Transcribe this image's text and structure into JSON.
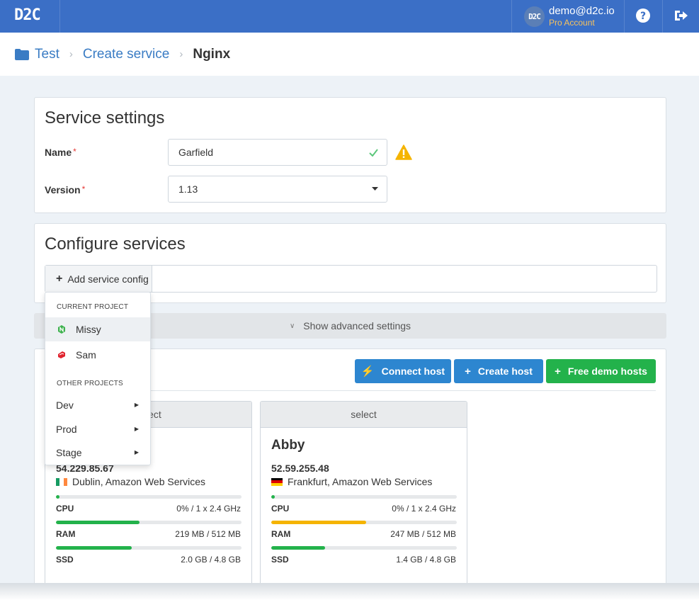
{
  "app": {
    "logo": "D2C"
  },
  "account": {
    "avatar_text": "D2C",
    "email": "demo@d2c.io",
    "plan": "Pro Account"
  },
  "breadcrumb": {
    "project": "Test",
    "step": "Create service",
    "current": "Nginx"
  },
  "service_settings": {
    "title": "Service settings",
    "name_label": "Name",
    "name_value": "Garfield",
    "version_label": "Version",
    "version_value": "1.13",
    "required_mark": "*"
  },
  "configure_services": {
    "title": "Configure services",
    "add_button_label": "Add service config"
  },
  "advanced": {
    "label": "Show advanced settings"
  },
  "hosts": {
    "buttons": {
      "connect": "Connect host",
      "create": "Create host",
      "demo": "Free demo hosts"
    },
    "cards": [
      {
        "select_label": "select",
        "name": "",
        "ip": "54.229.85.67",
        "location": "Dublin, Amazon Web Services",
        "flag_colors": [
          "#169b62",
          "#ffffff",
          "#ff883e"
        ],
        "cpu_label": "CPU",
        "cpu_value": "0% / 1 x 2.4 GHz",
        "cpu_fraction": 0.02,
        "cpu_color": "#23b24b",
        "ram_label": "RAM",
        "ram_value": "219 MB / 512 MB",
        "ram_fraction": 0.45,
        "ram_color": "#23b24b",
        "ssd_label": "SSD",
        "ssd_value": "2.0 GB / 4.8 GB",
        "ssd_fraction": 0.41,
        "ssd_color": "#23b24b"
      },
      {
        "select_label": "select",
        "name": "Abby",
        "ip": "52.59.255.48",
        "location": "Frankfurt, Amazon Web Services",
        "flag_colors": [
          "#000000",
          "#dd0000",
          "#ffce00"
        ],
        "cpu_label": "CPU",
        "cpu_value": "0% / 1 x 2.4 GHz",
        "cpu_fraction": 0.02,
        "cpu_color": "#23b24b",
        "ram_label": "RAM",
        "ram_value": "247 MB / 512 MB",
        "ram_fraction": 0.51,
        "ram_color": "#f5b400",
        "ssd_label": "SSD",
        "ssd_value": "1.4 GB / 4.8 GB",
        "ssd_fraction": 0.29,
        "ssd_color": "#23b24b"
      }
    ]
  },
  "dropdown": {
    "current_project_header": "CURRENT PROJECT",
    "current_items": [
      {
        "label": "Missy",
        "icon": "nginx-icon",
        "color": "#3fb24f"
      },
      {
        "label": "Sam",
        "icon": "laravel-icon",
        "color": "#e0242f"
      }
    ],
    "other_projects_header": "OTHER PROJECTS",
    "other_items": [
      {
        "label": "Dev"
      },
      {
        "label": "Prod"
      },
      {
        "label": "Stage"
      }
    ]
  },
  "colors": {
    "topbar": "#3b6fc6",
    "link": "#3a7cc4",
    "primary_button": "#2d86d0",
    "success_button": "#23b24b",
    "warning": "#f5b400"
  }
}
